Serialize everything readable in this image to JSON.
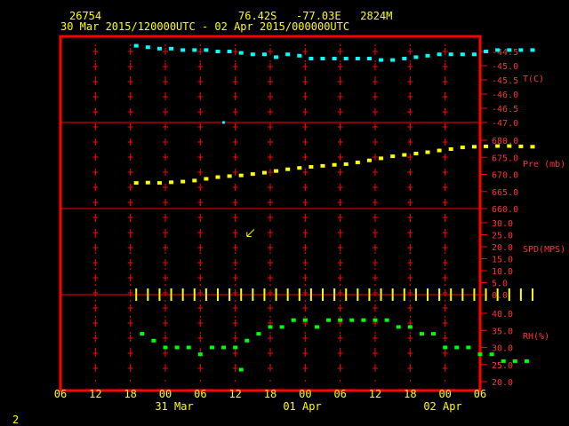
{
  "header": {
    "station_id": "26754",
    "coords": "76.42S   -77.03E   2824M",
    "time_range": "30 Mar 2015/120000UTC - 02 Apr 2015/000000UTC",
    "page_number": "2"
  },
  "colors": {
    "frame": "#ff0000",
    "text": "#ffff00",
    "label": "#ff3333",
    "temperature": "#00ffff",
    "pressure": "#ffff00",
    "wind": "#ffff00",
    "humidity": "#00ff00"
  },
  "x_axis": {
    "tick_labels": [
      "06",
      "12",
      "18",
      "00",
      "06",
      "12",
      "18",
      "00",
      "06",
      "12",
      "18",
      "00",
      "06"
    ],
    "day_labels": [
      "31 Mar",
      "01 Apr",
      "02 Apr"
    ]
  },
  "chart_data": [
    {
      "type": "scatter",
      "panel": "temperature",
      "ylabel": "T(C)",
      "ylim": [
        -47.0,
        -44.5
      ],
      "tick_labels": [
        "-44.5",
        "-45.0",
        "-45.5",
        "-46.0",
        "-46.5",
        "-47.0"
      ],
      "x_hours": [
        13,
        15,
        17,
        19,
        21,
        23,
        25,
        27,
        29,
        31,
        33,
        35,
        37,
        39,
        41,
        43,
        45,
        47,
        49,
        51,
        53,
        55,
        57,
        59,
        61,
        63,
        65,
        67,
        69,
        71,
        73,
        75,
        77,
        79,
        81
      ],
      "values": [
        -44.3,
        -44.35,
        -44.4,
        -44.4,
        -44.45,
        -44.45,
        -44.45,
        -44.5,
        -44.5,
        -44.55,
        -44.6,
        -44.6,
        -44.7,
        -44.6,
        -44.65,
        -44.75,
        -44.75,
        -44.75,
        -44.75,
        -44.75,
        -44.75,
        -44.8,
        -44.8,
        -44.75,
        -44.7,
        -44.65,
        -44.6,
        -44.6,
        -44.6,
        -44.6,
        -44.5,
        -44.45,
        -44.45,
        -44.45,
        -44.45
      ],
      "outliers": [
        {
          "x": 28,
          "y": -47.0
        }
      ]
    },
    {
      "type": "scatter",
      "panel": "pressure",
      "ylabel": "Pre (mb)",
      "ylim": [
        660.0,
        680.0
      ],
      "tick_labels": [
        "680.0",
        "675.0",
        "670.0",
        "665.0",
        "660.0"
      ],
      "x_hours": [
        13,
        15,
        17,
        19,
        21,
        23,
        25,
        27,
        29,
        31,
        33,
        35,
        37,
        39,
        41,
        43,
        45,
        47,
        49,
        51,
        53,
        55,
        57,
        59,
        61,
        63,
        65,
        67,
        69,
        71,
        73,
        75,
        77,
        79,
        81
      ],
      "values": [
        667.5,
        667.6,
        667.5,
        667.7,
        667.9,
        668.2,
        668.7,
        669.2,
        669.5,
        669.7,
        670.1,
        670.5,
        671.0,
        671.5,
        671.9,
        672.2,
        672.5,
        672.8,
        673.0,
        673.5,
        674.1,
        674.7,
        675.3,
        675.7,
        676.1,
        676.5,
        677.0,
        677.4,
        677.9,
        678.1,
        678.2,
        678.3,
        678.3,
        678.2,
        678.1
      ]
    },
    {
      "type": "scatter",
      "panel": "wind",
      "ylabel": "SPD(MPS)",
      "ylim": [
        0.0,
        30.0
      ],
      "tick_labels": [
        "30.0",
        "25.0",
        "20.0",
        "15.0",
        "10.0",
        "5.0",
        "0.0"
      ],
      "x_hours": [
        13,
        15,
        17,
        19,
        21,
        23,
        25,
        27,
        29,
        31,
        33,
        35,
        37,
        39,
        41,
        43,
        45,
        47,
        49,
        51,
        53,
        55,
        57,
        59,
        61,
        63,
        65,
        67,
        69,
        71,
        73,
        75,
        77,
        79,
        81
      ],
      "values": [
        0,
        0,
        0,
        0,
        0,
        0,
        0,
        0,
        0,
        0,
        0,
        0,
        0,
        0,
        0,
        0,
        0,
        0,
        0,
        0,
        0,
        0,
        0,
        0,
        0,
        0,
        0,
        0,
        0,
        0,
        0,
        0,
        0,
        0,
        0
      ],
      "direction_arrows": [
        {
          "x": 32,
          "y": 25
        }
      ]
    },
    {
      "type": "scatter",
      "panel": "humidity",
      "ylabel": "RH(%)",
      "ylim": [
        20.0,
        40.0
      ],
      "tick_labels": [
        "40.0",
        "35.0",
        "30.0",
        "25.0",
        "20.0"
      ],
      "x_hours": [
        14,
        16,
        18,
        20,
        22,
        24,
        26,
        28,
        30,
        31,
        32,
        34,
        36,
        38,
        40,
        42,
        44,
        46,
        48,
        50,
        52,
        54,
        56,
        58,
        60,
        62,
        64,
        66,
        68,
        70,
        72,
        74,
        76,
        78,
        80
      ],
      "values": [
        34,
        32,
        30,
        30,
        30,
        28,
        30,
        30,
        30,
        23.5,
        32,
        34,
        36,
        36,
        38,
        38,
        36,
        38,
        38,
        38,
        38,
        38,
        38,
        36,
        36,
        34,
        34,
        30,
        30,
        30,
        28,
        28,
        26,
        26,
        26
      ]
    }
  ]
}
